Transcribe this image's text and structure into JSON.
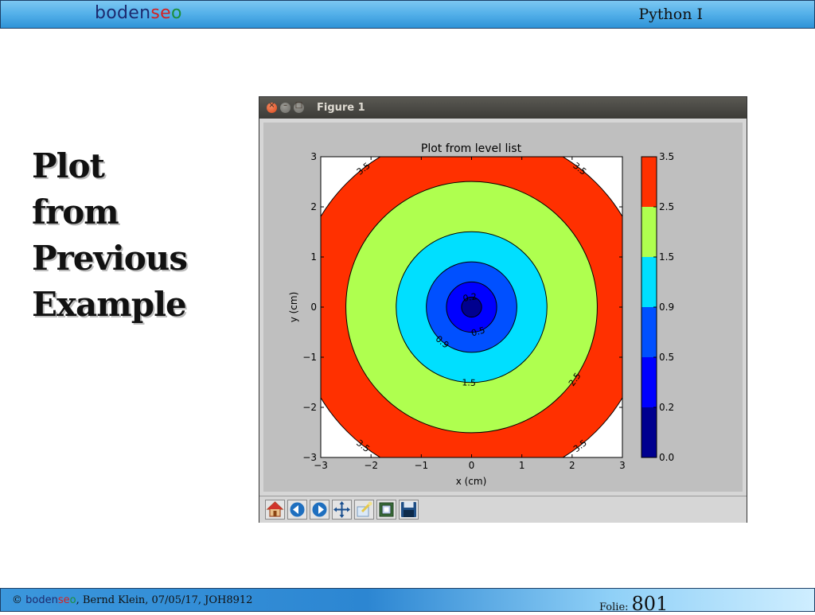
{
  "header": {
    "brand_main": "boden",
    "brand_s": "se",
    "brand_o": "o",
    "course": "Python I"
  },
  "slide": {
    "title_lines": [
      "Plot",
      "from",
      "Previous",
      "Example"
    ]
  },
  "window": {
    "title": "Figure 1"
  },
  "toolbar": {
    "icons": [
      "home-icon",
      "back-icon",
      "forward-icon",
      "pan-icon",
      "zoom-icon",
      "configure-subplots-icon",
      "save-icon"
    ]
  },
  "footer": {
    "copyright": "©",
    "brand_main": "boden",
    "brand_s": "se",
    "brand_o": "o",
    "credit": ", Bernd Klein, 07/05/17, JOH8912",
    "folie_label": "Folie:",
    "folie_number": "801"
  },
  "colors": {
    "header_blue": "#56b2ea",
    "footer_blue": "#2c86d2"
  },
  "chart_data": {
    "type": "contourf",
    "title": "Plot from level list",
    "xlabel": "x (cm)",
    "ylabel": "y (cm)",
    "xlim": [
      -3,
      3
    ],
    "ylim": [
      -3,
      3
    ],
    "x_ticks": [
      -3,
      -2,
      -1,
      0,
      1,
      2,
      3
    ],
    "y_ticks": [
      -3,
      -2,
      -1,
      0,
      1,
      2,
      3
    ],
    "x_tick_labels": [
      "−3",
      "−2",
      "−1",
      "0",
      "1",
      "2",
      "3"
    ],
    "y_tick_labels": [
      "−3",
      "−2",
      "−1",
      "0",
      "1",
      "2",
      "3"
    ],
    "function": "sqrt(x^2 + y^2)",
    "levels": [
      0.0,
      0.2,
      0.5,
      0.9,
      1.5,
      2.5,
      3.5
    ],
    "level_colors": [
      "#00008f",
      "#0000ff",
      "#0050ff",
      "#00dfff",
      "#afff4f",
      "#ff3000"
    ],
    "above_top_color": "#ffffff",
    "contour_labels": [
      {
        "text": "0.2",
        "level": 0.2,
        "angle": 100
      },
      {
        "text": "0.5",
        "level": 0.5,
        "angle": -75
      },
      {
        "text": "0.9",
        "level": 0.9,
        "angle": -130
      },
      {
        "text": "1.5",
        "level": 1.5,
        "angle": -92
      },
      {
        "text": "2.5",
        "level": 2.5,
        "angle": -35
      },
      {
        "text": "3.5",
        "level": 3.5,
        "angle": 128
      },
      {
        "text": "3.5",
        "level": 3.5,
        "angle": 52
      },
      {
        "text": "3.5",
        "level": 3.5,
        "angle": -128
      },
      {
        "text": "3.5",
        "level": 3.5,
        "angle": -52
      }
    ],
    "colorbar": {
      "ticks": [
        "3.5",
        "2.5",
        "1.5",
        "0.9",
        "0.5",
        "0.2",
        "0.0"
      ]
    }
  }
}
